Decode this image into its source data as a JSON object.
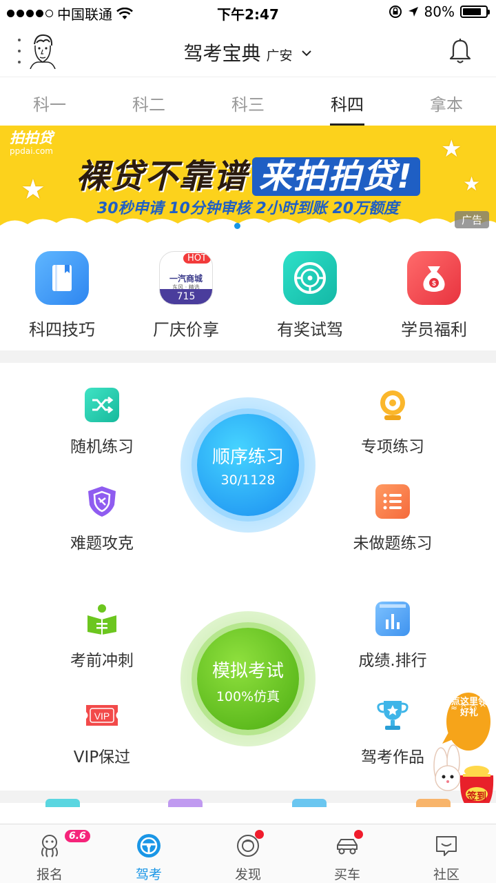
{
  "status_bar": {
    "carrier": "中国联通",
    "time": "下午2:47",
    "battery": "80%",
    "battery_level": 0.8
  },
  "header": {
    "title": "驾考宝典",
    "city": "广安"
  },
  "tabs": [
    {
      "label": "科一",
      "active": false
    },
    {
      "label": "科二",
      "active": false
    },
    {
      "label": "科三",
      "active": false
    },
    {
      "label": "科四",
      "active": true
    },
    {
      "label": "拿本",
      "active": false
    }
  ],
  "banner": {
    "brand": "拍拍贷",
    "brand_url": "ppdai.com",
    "headline_left": "裸贷不靠谱",
    "headline_right": "来拍拍贷!",
    "subline": "30秒申请  10分钟审核  2小时到账  20万额度",
    "ad_label": "广告",
    "page_count": 2,
    "active_page": 0
  },
  "quick_grid": [
    {
      "label": "科四技巧",
      "icon": "book-icon"
    },
    {
      "label": "厂庆价享",
      "icon": "car-promo-icon",
      "hot": "HOT",
      "tile_top": "一汽商城",
      "tile_sub": "东风 · 精选",
      "tile_number": "715"
    },
    {
      "label": "有奖试驾",
      "icon": "steering-wheel-icon"
    },
    {
      "label": "学员福利",
      "icon": "money-bag-icon"
    }
  ],
  "practice": {
    "sequential": {
      "title": "顺序练习",
      "progress": "30/1128"
    },
    "random": {
      "label": "随机练习",
      "icon": "shuffle-icon"
    },
    "topic": {
      "label": "专项练习",
      "icon": "target-icon"
    },
    "hard": {
      "label": "难题攻克",
      "icon": "shield-icon"
    },
    "undone": {
      "label": "未做题练习",
      "icon": "list-icon"
    }
  },
  "exam": {
    "mock": {
      "title": "模拟考试",
      "subtitle": "100%仿真"
    },
    "sprint": {
      "label": "考前冲刺",
      "icon": "reading-icon"
    },
    "scores": {
      "label": "成绩.排行",
      "icon": "bar-chart-icon"
    },
    "vip": {
      "label": "VIP保过",
      "icon": "vip-ticket-icon",
      "badge": "VIP"
    },
    "works": {
      "label": "驾考作品",
      "icon": "trophy-icon"
    }
  },
  "promo": {
    "bubble": "点这里领好礼",
    "bag_label": "签到"
  },
  "bottom_nav": [
    {
      "label": "报名",
      "icon": "octopus-icon",
      "badge": "6.6"
    },
    {
      "label": "驾考",
      "icon": "steering-icon",
      "active": true
    },
    {
      "label": "发现",
      "icon": "discover-icon",
      "dot": true
    },
    {
      "label": "买车",
      "icon": "car-icon",
      "dot": true
    },
    {
      "label": "社区",
      "icon": "chat-icon"
    }
  ],
  "colors": {
    "accent": "#1a96e6",
    "banner_bg": "#fcd21c",
    "blue_circle": "#1e9cf0",
    "green_circle": "#5cc21a",
    "red_dot": "#f01c2c"
  }
}
